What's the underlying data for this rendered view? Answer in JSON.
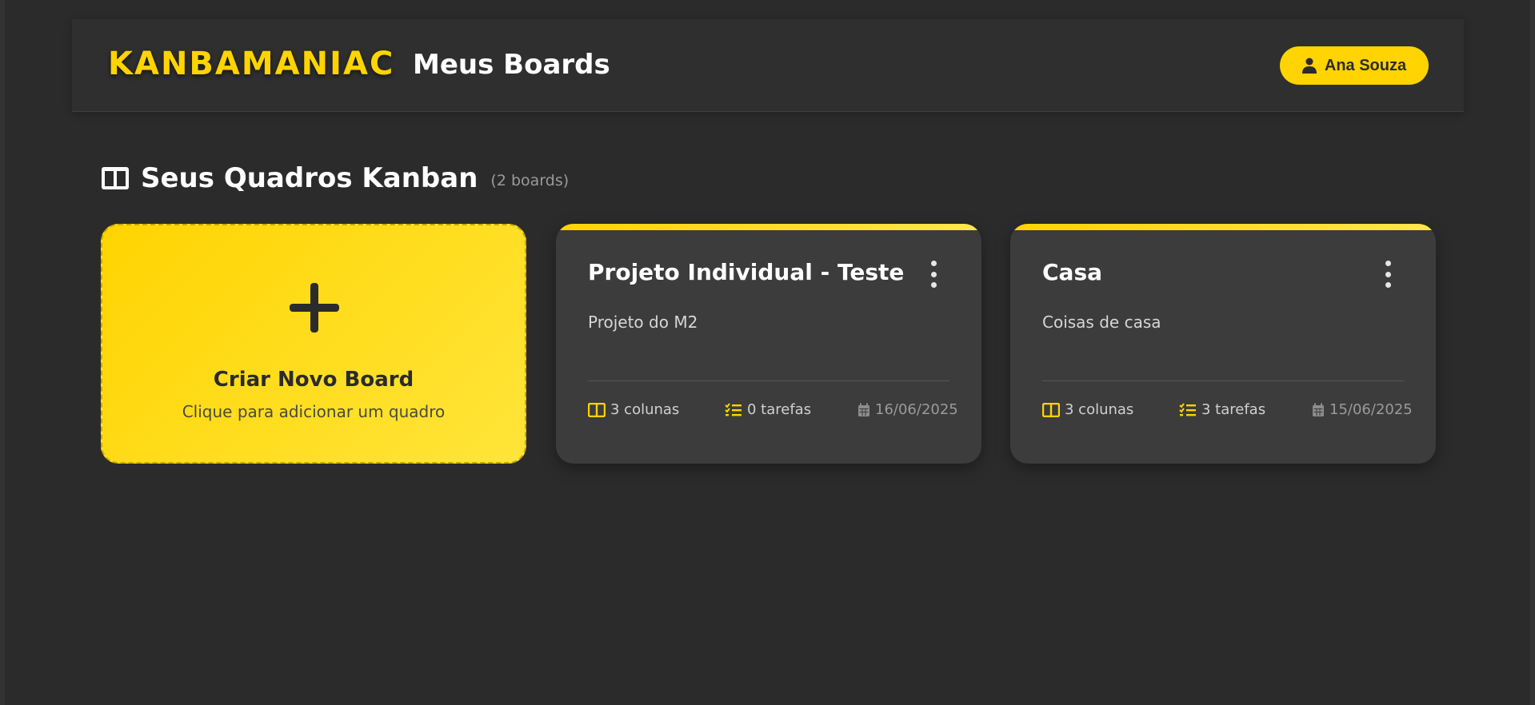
{
  "header": {
    "logo": "KANBAMANIAC",
    "title": "Meus Boards",
    "user_name": "Ana Souza"
  },
  "section": {
    "title": "Seus Quadros Kanban",
    "count": "(2 boards)"
  },
  "new_board": {
    "title": "Criar Novo Board",
    "subtitle": "Clique para adicionar um quadro"
  },
  "boards": [
    {
      "title": "Projeto Individual - Teste",
      "description": "Projeto do M2",
      "columns": "3 colunas",
      "tasks": "0 tarefas",
      "date": "16/06/2025"
    },
    {
      "title": "Casa",
      "description": "Coisas de casa",
      "columns": "3 colunas",
      "tasks": "3 tarefas",
      "date": "15/06/2025"
    }
  ],
  "colors": {
    "accent": "#ffd400",
    "background": "#2b2b2b",
    "card": "#3c3c3c"
  },
  "icons": [
    "user-icon",
    "book-icon",
    "plus-icon",
    "kebab-menu-icon",
    "columns-icon",
    "tasks-icon",
    "calendar-icon"
  ]
}
